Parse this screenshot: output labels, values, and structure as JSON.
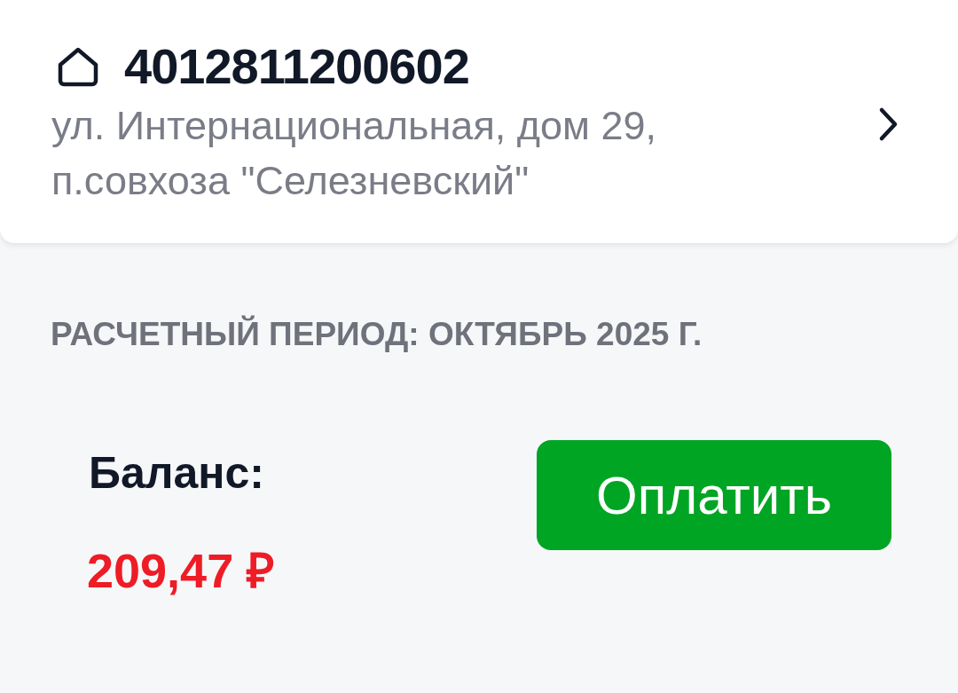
{
  "account": {
    "number": "4012811200602",
    "address": "ул. Интернациональная, дом 29, п.совхоза \"Селезневский\""
  },
  "period_label": "РАСЧЕТНЫЙ ПЕРИОД: ОКТЯБРЬ 2025 Г.",
  "balance": {
    "label": "Баланс:",
    "amount": "209,47 ₽"
  },
  "pay_button": "Оплатить"
}
